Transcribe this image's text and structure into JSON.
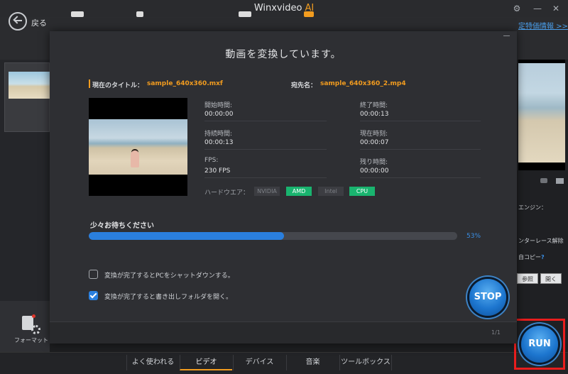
{
  "app": {
    "title": "Winxvideo",
    "title_ai": "AI"
  },
  "window": {
    "gear_icon": "gear-icon",
    "minimize": "—",
    "close": "✕"
  },
  "toolbar": {
    "back_label": "戻る",
    "special_link": "定特価情報 >>"
  },
  "left": {
    "format_label": "フォーマット"
  },
  "right_panel": {
    "engine_label": "エンジン：",
    "deinterlace": "ンターレース解除",
    "copy_label": "自コピー",
    "help": "?",
    "browse_button": "参照",
    "open_button": "開く"
  },
  "dialog": {
    "title": "動画を変換しています。",
    "current_title_label": "現在のタイトル：",
    "current_title_value": "sample_640x360.mxf",
    "destination_label": "宛先名：",
    "destination_value": "sample_640x360_2.mp4",
    "info": {
      "start_label": "開始時間:",
      "start_value": "00:00:00",
      "end_label": "終了時間:",
      "end_value": "00:00:13",
      "duration_label": "持続時間:",
      "duration_value": "00:00:13",
      "current_label": "現在時刻:",
      "current_value": "00:00:07",
      "fps_label": "FPS:",
      "fps_value": "230 FPS",
      "remaining_label": "残り時間:",
      "remaining_value": "00:00:00"
    },
    "hardware": {
      "label": "ハードウエア：",
      "chips": [
        {
          "label": "NVIDIA",
          "active": false
        },
        {
          "label": "AMD",
          "active": true
        },
        {
          "label": "Intel",
          "active": false
        },
        {
          "label": "CPU",
          "active": true
        }
      ]
    },
    "progress": {
      "label": "少々お待ちください",
      "percent": 53,
      "percent_text": "53%"
    },
    "options": [
      {
        "label": "変換が完了するとPCをシャットダウンする。",
        "checked": false
      },
      {
        "label": "変換が完了すると書き出しフォルダを開く。",
        "checked": true
      }
    ],
    "stop_label": "STOP",
    "page": "1/1"
  },
  "run_label": "RUN",
  "nav_tabs": [
    {
      "label": "よく使われる",
      "active": false
    },
    {
      "label": "ビデオ",
      "active": true
    },
    {
      "label": "デバイス",
      "active": false
    },
    {
      "label": "音楽",
      "active": false
    },
    {
      "label": "ツールボックス",
      "active": false
    }
  ],
  "colors": {
    "accent": "#f29c1f",
    "progress": "#2a7fde",
    "hw_active": "#19b46f",
    "highlight_frame": "#e81d1d"
  }
}
